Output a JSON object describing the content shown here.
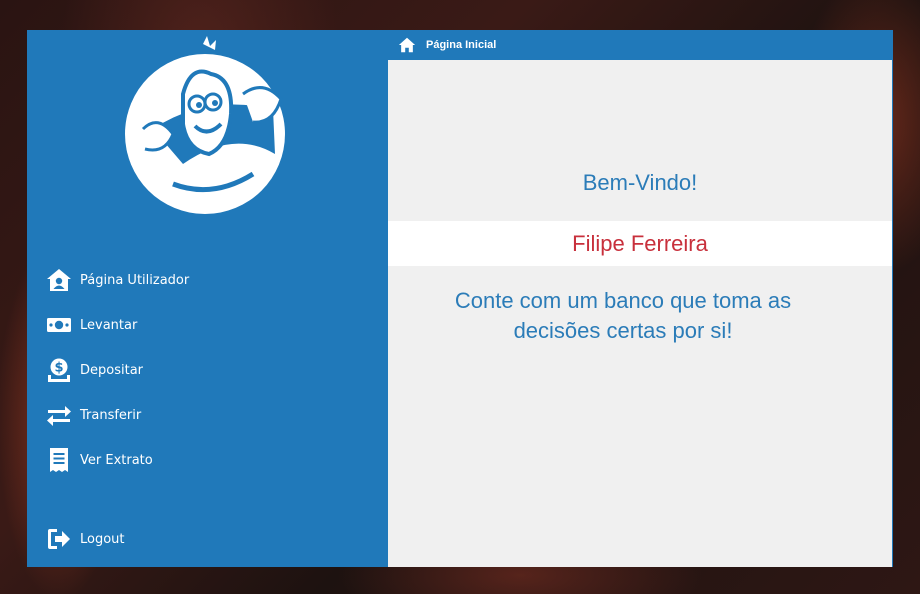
{
  "window": {
    "title": "Página Inicial"
  },
  "sidebar": {
    "logo": {
      "icon": "monster-mascot-logo"
    },
    "items": [
      {
        "label": "Página Utilizador",
        "icon": "user-home-icon"
      },
      {
        "label": "Levantar",
        "icon": "cash-icon"
      },
      {
        "label": "Depositar",
        "icon": "dollar-deposit-icon"
      },
      {
        "label": "Transferir",
        "icon": "transfer-arrows-icon"
      },
      {
        "label": "Ver Extrato",
        "icon": "receipt-icon"
      }
    ],
    "logout": {
      "label": "Logout",
      "icon": "sign-out-icon"
    }
  },
  "main": {
    "welcome": "Bem-Vindo!",
    "user_name": "Filipe Ferreira",
    "slogan": "Conte com um banco que toma as decisões certas por si!"
  },
  "colors": {
    "primary": "#2079ba",
    "panel": "#f0f0f0",
    "text_blue": "#2b7cb8",
    "name_red": "#c8303c"
  }
}
